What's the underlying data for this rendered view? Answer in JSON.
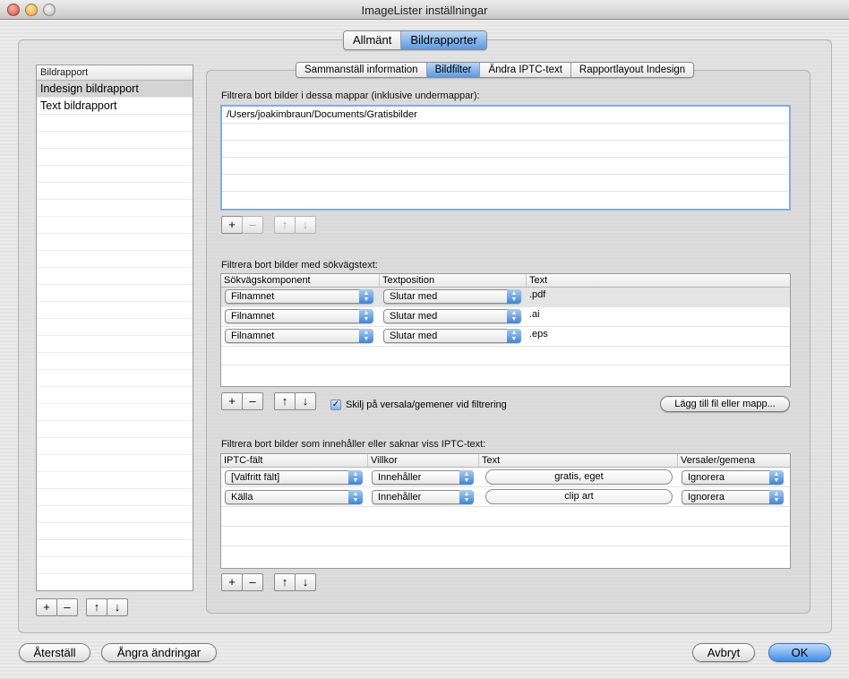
{
  "window": {
    "title": "ImageLister inställningar"
  },
  "main_tabs": [
    {
      "label": "Allmänt",
      "selected": false
    },
    {
      "label": "Bildrapporter",
      "selected": true
    }
  ],
  "sub_tabs": [
    {
      "label": "Sammanställ information",
      "selected": false
    },
    {
      "label": "Bildfilter",
      "selected": true
    },
    {
      "label": "Ändra IPTC-text",
      "selected": false
    },
    {
      "label": "Rapportlayout Indesign",
      "selected": false
    }
  ],
  "report_list": {
    "header": "Bildrapport",
    "items": [
      {
        "label": "Indesign bildrapport",
        "selected": true
      },
      {
        "label": "Text bildrapport",
        "selected": false
      }
    ]
  },
  "list_buttons": {
    "add": "+",
    "remove": "–",
    "up": "↑",
    "down": "↓"
  },
  "folders": {
    "label": "Filtrera bort bilder i dessa mappar (inklusive undermappar):",
    "items": [
      "/Users/joakimbraun/Documents/Gratisbilder"
    ]
  },
  "path_filter": {
    "label": "Filtrera bort bilder med sökvägstext:",
    "columns": [
      "Sökvägskomponent",
      "Textposition",
      "Text"
    ],
    "rows": [
      {
        "component": "Filnamnet",
        "position": "Slutar med",
        "text": ".pdf"
      },
      {
        "component": "Filnamnet",
        "position": "Slutar med",
        "text": ".ai"
      },
      {
        "component": "Filnamnet",
        "position": "Slutar med",
        "text": ".eps"
      }
    ],
    "case_checkbox": {
      "label": "Skilj på versala/gemener vid filtrering",
      "checked": true
    },
    "add_file_button": "Lägg till fil eller mapp..."
  },
  "iptc_filter": {
    "label": "Filtrera bort bilder som innehåller eller saknar viss IPTC-text:",
    "columns": [
      "IPTC-fält",
      "Villkor",
      "Text",
      "Versaler/gemena"
    ],
    "rows": [
      {
        "field": "[Valfritt fält]",
        "condition": "Innehåller",
        "text": "gratis, eget",
        "case": "Ignorera"
      },
      {
        "field": "Källa",
        "condition": "Innehåller",
        "text": "clip art",
        "case": "Ignorera"
      }
    ]
  },
  "footer": {
    "reset": "Återställ",
    "undo": "Ångra ändringar",
    "cancel": "Avbryt",
    "ok": "OK"
  },
  "colors": {
    "accent": "#3f8ee6",
    "selection": "#d4d4d4"
  }
}
